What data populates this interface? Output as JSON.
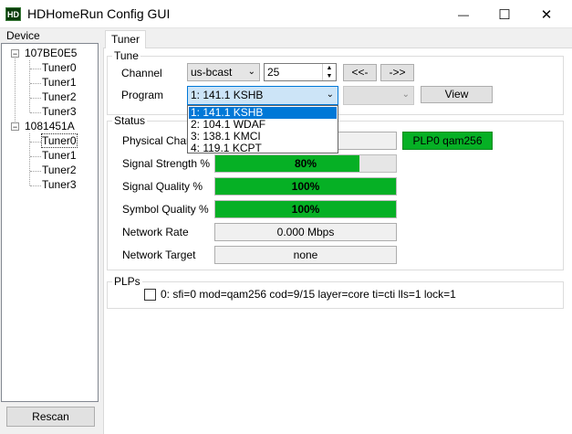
{
  "window": {
    "title": "HDHomeRun Config GUI",
    "icon_text": "HD",
    "minimize_glyph": "—",
    "maximize_glyph": "☐",
    "close_glyph": "✕"
  },
  "sidebar": {
    "label": "Device",
    "devices": [
      {
        "id": "107BE0E5",
        "toggle": "−",
        "tuners": [
          "Tuner0",
          "Tuner1",
          "Tuner2",
          "Tuner3"
        ]
      },
      {
        "id": "1081451A",
        "toggle": "−",
        "tuners": [
          "Tuner0",
          "Tuner1",
          "Tuner2",
          "Tuner3"
        ]
      }
    ],
    "selected": "1081451A / Tuner0",
    "rescan_label": "Rescan"
  },
  "tabs": [
    {
      "label": "Tuner",
      "active": true
    }
  ],
  "tune": {
    "legend": "Tune",
    "channel_label": "Channel",
    "channel_map": "us-bcast",
    "channel_value": "25",
    "prev_label": "<<-",
    "next_label": "->>",
    "program_label": "Program",
    "program_selected": "1: 141.1 KSHB",
    "program_options": [
      "1: 141.1 KSHB",
      "2: 104.1 WDAF",
      "3: 138.1 KMCI",
      "4: 119.1 KCPT"
    ],
    "view_label": "View"
  },
  "status": {
    "legend": "Status",
    "physical_channel_label": "Physical Chann",
    "plp_badge": "PLP0 qam256",
    "signal_strength_label": "Signal Strength %",
    "signal_strength_text": "80%",
    "signal_strength_value": 80,
    "signal_quality_label": "Signal Quality %",
    "signal_quality_text": "100%",
    "signal_quality_value": 100,
    "symbol_quality_label": "Symbol Quality %",
    "symbol_quality_text": "100%",
    "symbol_quality_value": 100,
    "network_rate_label": "Network Rate",
    "network_rate": "0.000 Mbps",
    "network_target_label": "Network Target",
    "network_target": "none"
  },
  "plps": {
    "legend": "PLPs",
    "items": [
      {
        "checked": false,
        "text": "0: sfi=0 mod=qam256 cod=9/15 layer=core ti=cti lls=1 lock=1"
      }
    ]
  },
  "colors": {
    "meter_green": "#06b025",
    "selection_blue": "#0078d7"
  }
}
